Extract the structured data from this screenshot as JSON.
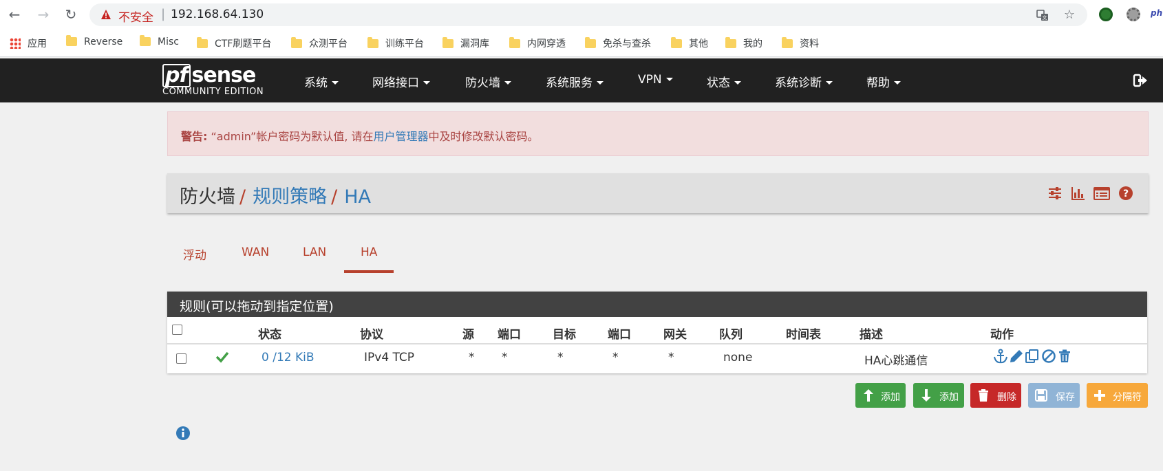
{
  "browser": {
    "insecure_label": "不安全",
    "separator": "|",
    "url": "192.168.64.130",
    "ext_text": "ph"
  },
  "bookmarks": [
    {
      "label": "应用"
    },
    {
      "label": "Reverse"
    },
    {
      "label": "Misc"
    },
    {
      "label": "CTF刷题平台"
    },
    {
      "label": "众测平台"
    },
    {
      "label": "训练平台"
    },
    {
      "label": "漏洞库"
    },
    {
      "label": "内网穿透"
    },
    {
      "label": "免杀与查杀"
    },
    {
      "label": "其他"
    },
    {
      "label": "我的"
    },
    {
      "label": "资料"
    }
  ],
  "pfsense": {
    "logo_pf": "pf",
    "logo_sense": "sense",
    "logo_sub": "COMMUNITY EDITION",
    "menu": [
      {
        "label": "系统"
      },
      {
        "label": "网络接口"
      },
      {
        "label": "防火墙"
      },
      {
        "label": "系统服务"
      },
      {
        "label": "VPN"
      },
      {
        "label": "状态"
      },
      {
        "label": "系统诊断"
      },
      {
        "label": "帮助"
      }
    ]
  },
  "alert": {
    "prefix": "警告:",
    "text_before": " “admin”帐户密码为默认值, 请在",
    "link": "用户管理器",
    "text_after": "中及时修改默认密码。"
  },
  "breadcrumb": {
    "part1": "防火墙",
    "sep": "/",
    "part2": "规则策略",
    "part3": "HA"
  },
  "tabs": [
    {
      "label": "浮动"
    },
    {
      "label": "WAN"
    },
    {
      "label": "LAN"
    },
    {
      "label": "HA",
      "active": true
    }
  ],
  "rules": {
    "title": "规则(可以拖动到指定位置)",
    "columns": [
      "状态",
      "协议",
      "源",
      "端口",
      "目标",
      "端口",
      "网关",
      "队列",
      "时间表",
      "描述",
      "动作"
    ],
    "rows": [
      {
        "states": "0 /12 KiB",
        "protocol": "IPv4 TCP",
        "source": "*",
        "source_port": "*",
        "destination": "*",
        "destination_port": "*",
        "gateway": "*",
        "queue": "none",
        "schedule": "",
        "description": "HA心跳通信"
      }
    ]
  },
  "buttons": {
    "add_top": "添加",
    "add_bottom": "添加",
    "delete": "删除",
    "save": "保存",
    "separator": "分隔符"
  },
  "colors": {
    "navbar": "#212121",
    "accent_red": "#b7412d",
    "link_blue": "#337ab7",
    "alert_bg": "#f2dede",
    "green": "#43a047"
  }
}
